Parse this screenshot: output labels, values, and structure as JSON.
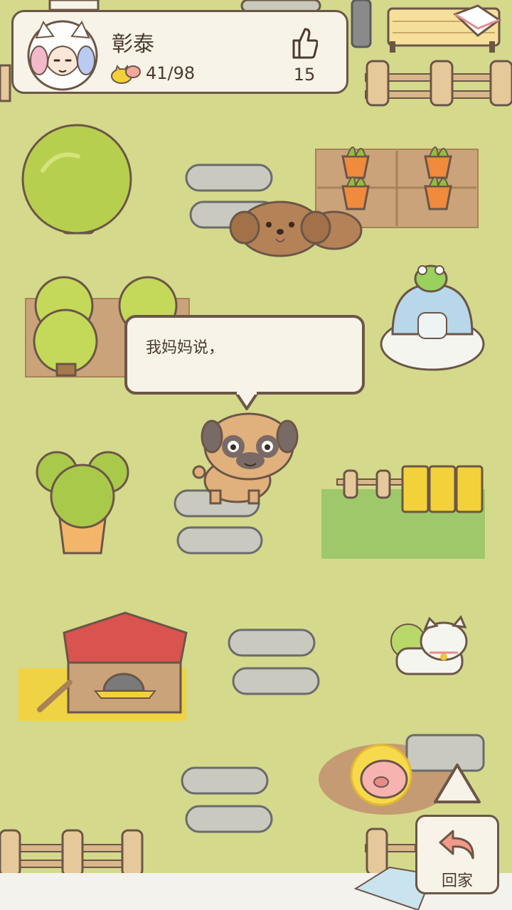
{
  "profile": {
    "name": "彰泰",
    "progress": "41/98",
    "likes": "15"
  },
  "speech": {
    "text": "我妈妈说，"
  },
  "home_button": {
    "label": "回家"
  },
  "icons": {
    "like": "thumbs-up-icon",
    "currency": "chick-icon",
    "home": "return-arrow-icon",
    "scroll_up": "chevron-up-icon"
  },
  "colors": {
    "grass": "#d5d98c",
    "outline": "#6b5647",
    "panel": "#f7f3e8",
    "dirt": "#c9a77a",
    "roof": "#d9534f",
    "hay": "#f3d13b"
  }
}
